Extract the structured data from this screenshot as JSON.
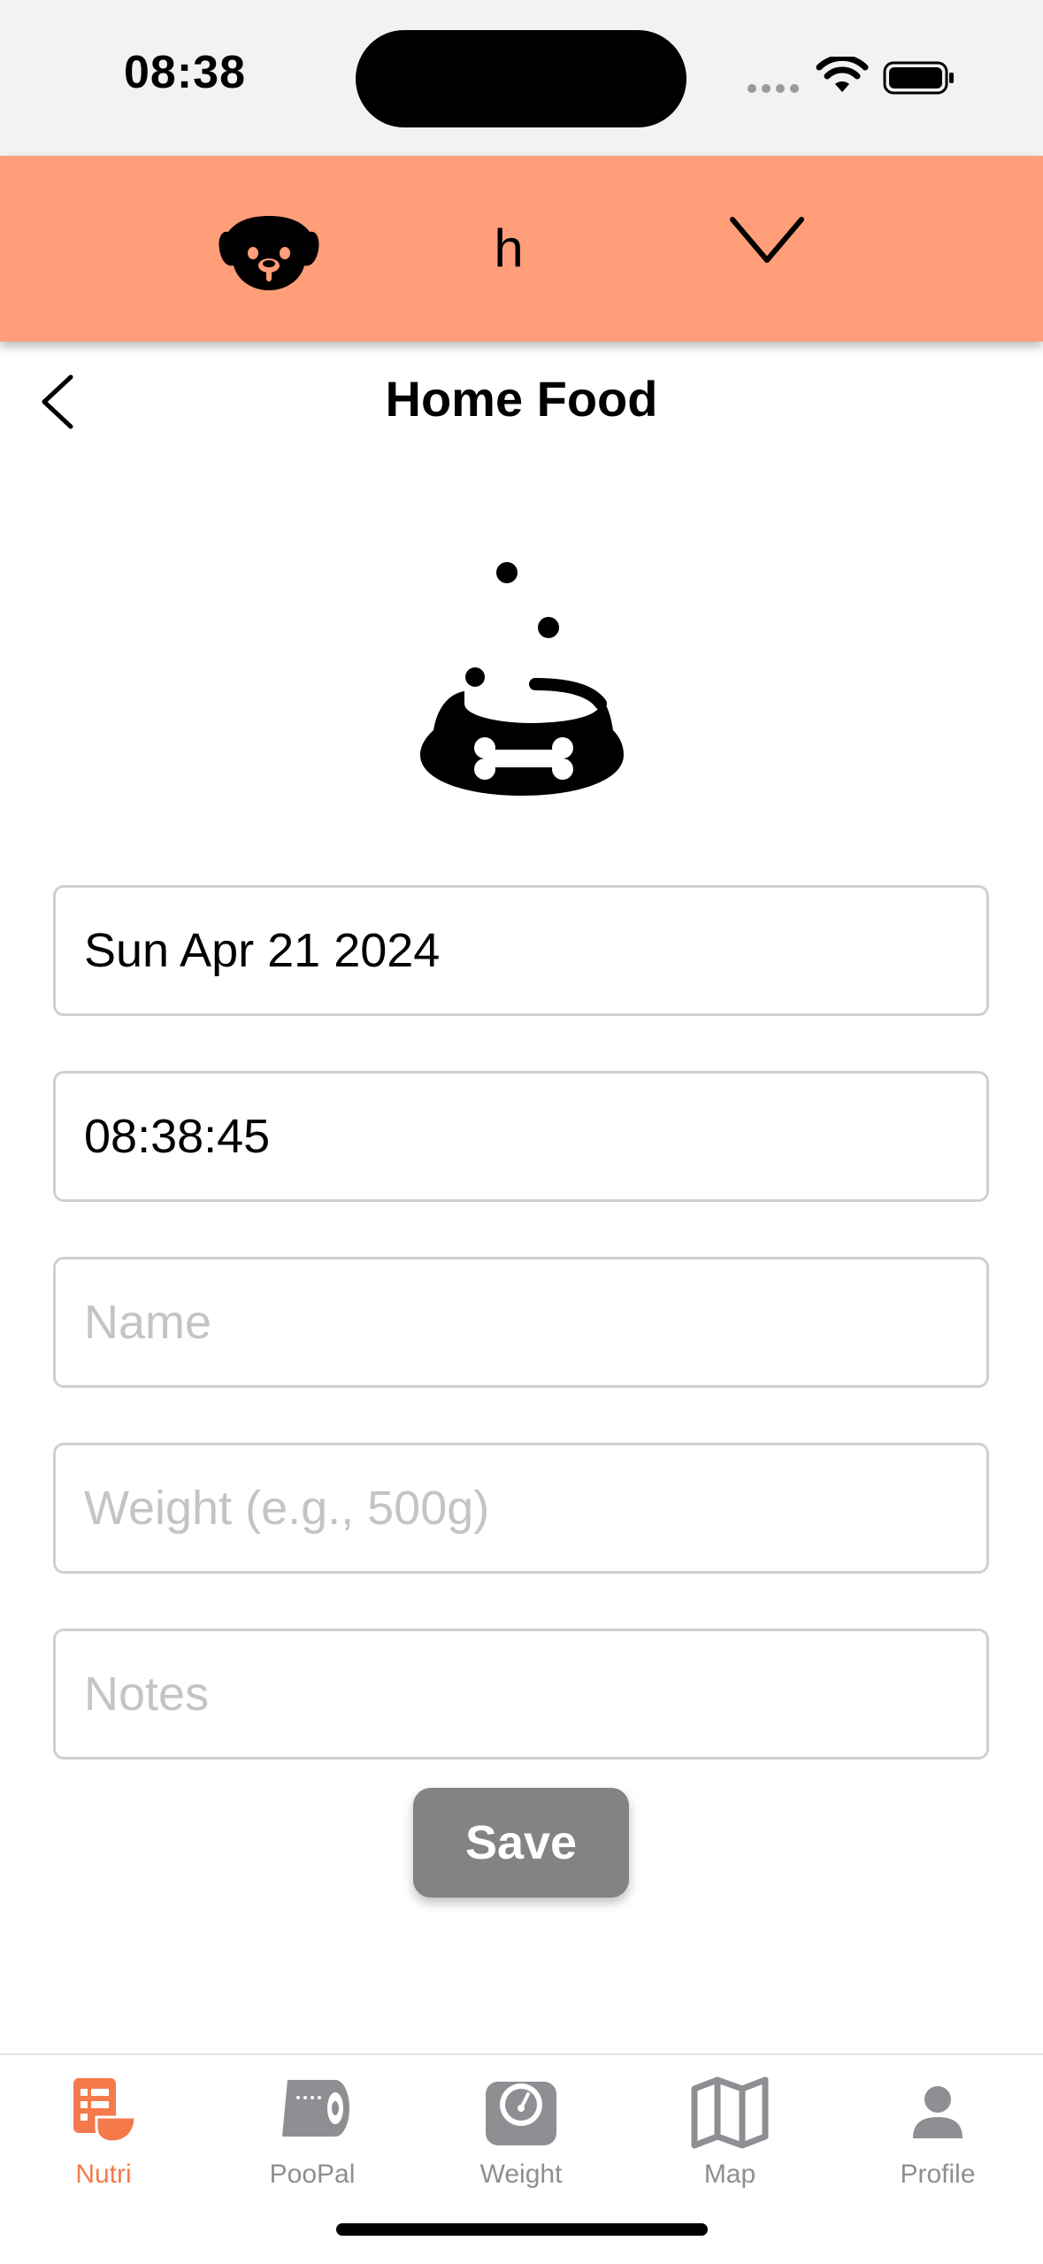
{
  "status_bar": {
    "time": "08:38"
  },
  "pet_selector": {
    "name": "h",
    "avatar_icon": "dog-face-icon",
    "dropdown_icon": "chevron-down-icon"
  },
  "header": {
    "title": "Home Food",
    "back_icon": "chevron-left-icon"
  },
  "hero_icon": "dog-bowl-icon",
  "form": {
    "date_value": "Sun Apr 21 2024",
    "time_value": "08:38:45",
    "name_placeholder": "Name",
    "weight_placeholder": "Weight (e.g., 500g)",
    "notes_placeholder": "Notes",
    "save_label": "Save"
  },
  "tabs": [
    {
      "label": "Nutri",
      "icon": "nutrition-icon",
      "active": true
    },
    {
      "label": "PooPal",
      "icon": "toilet-roll-icon",
      "active": false
    },
    {
      "label": "Weight",
      "icon": "scale-icon",
      "active": false
    },
    {
      "label": "Map",
      "icon": "map-icon",
      "active": false
    },
    {
      "label": "Profile",
      "icon": "person-icon",
      "active": false
    }
  ],
  "colors": {
    "accent": "#ff9e78",
    "active_tab": "#f47a4c",
    "inactive_tab": "#8e8e93",
    "save_button": "#838383"
  }
}
